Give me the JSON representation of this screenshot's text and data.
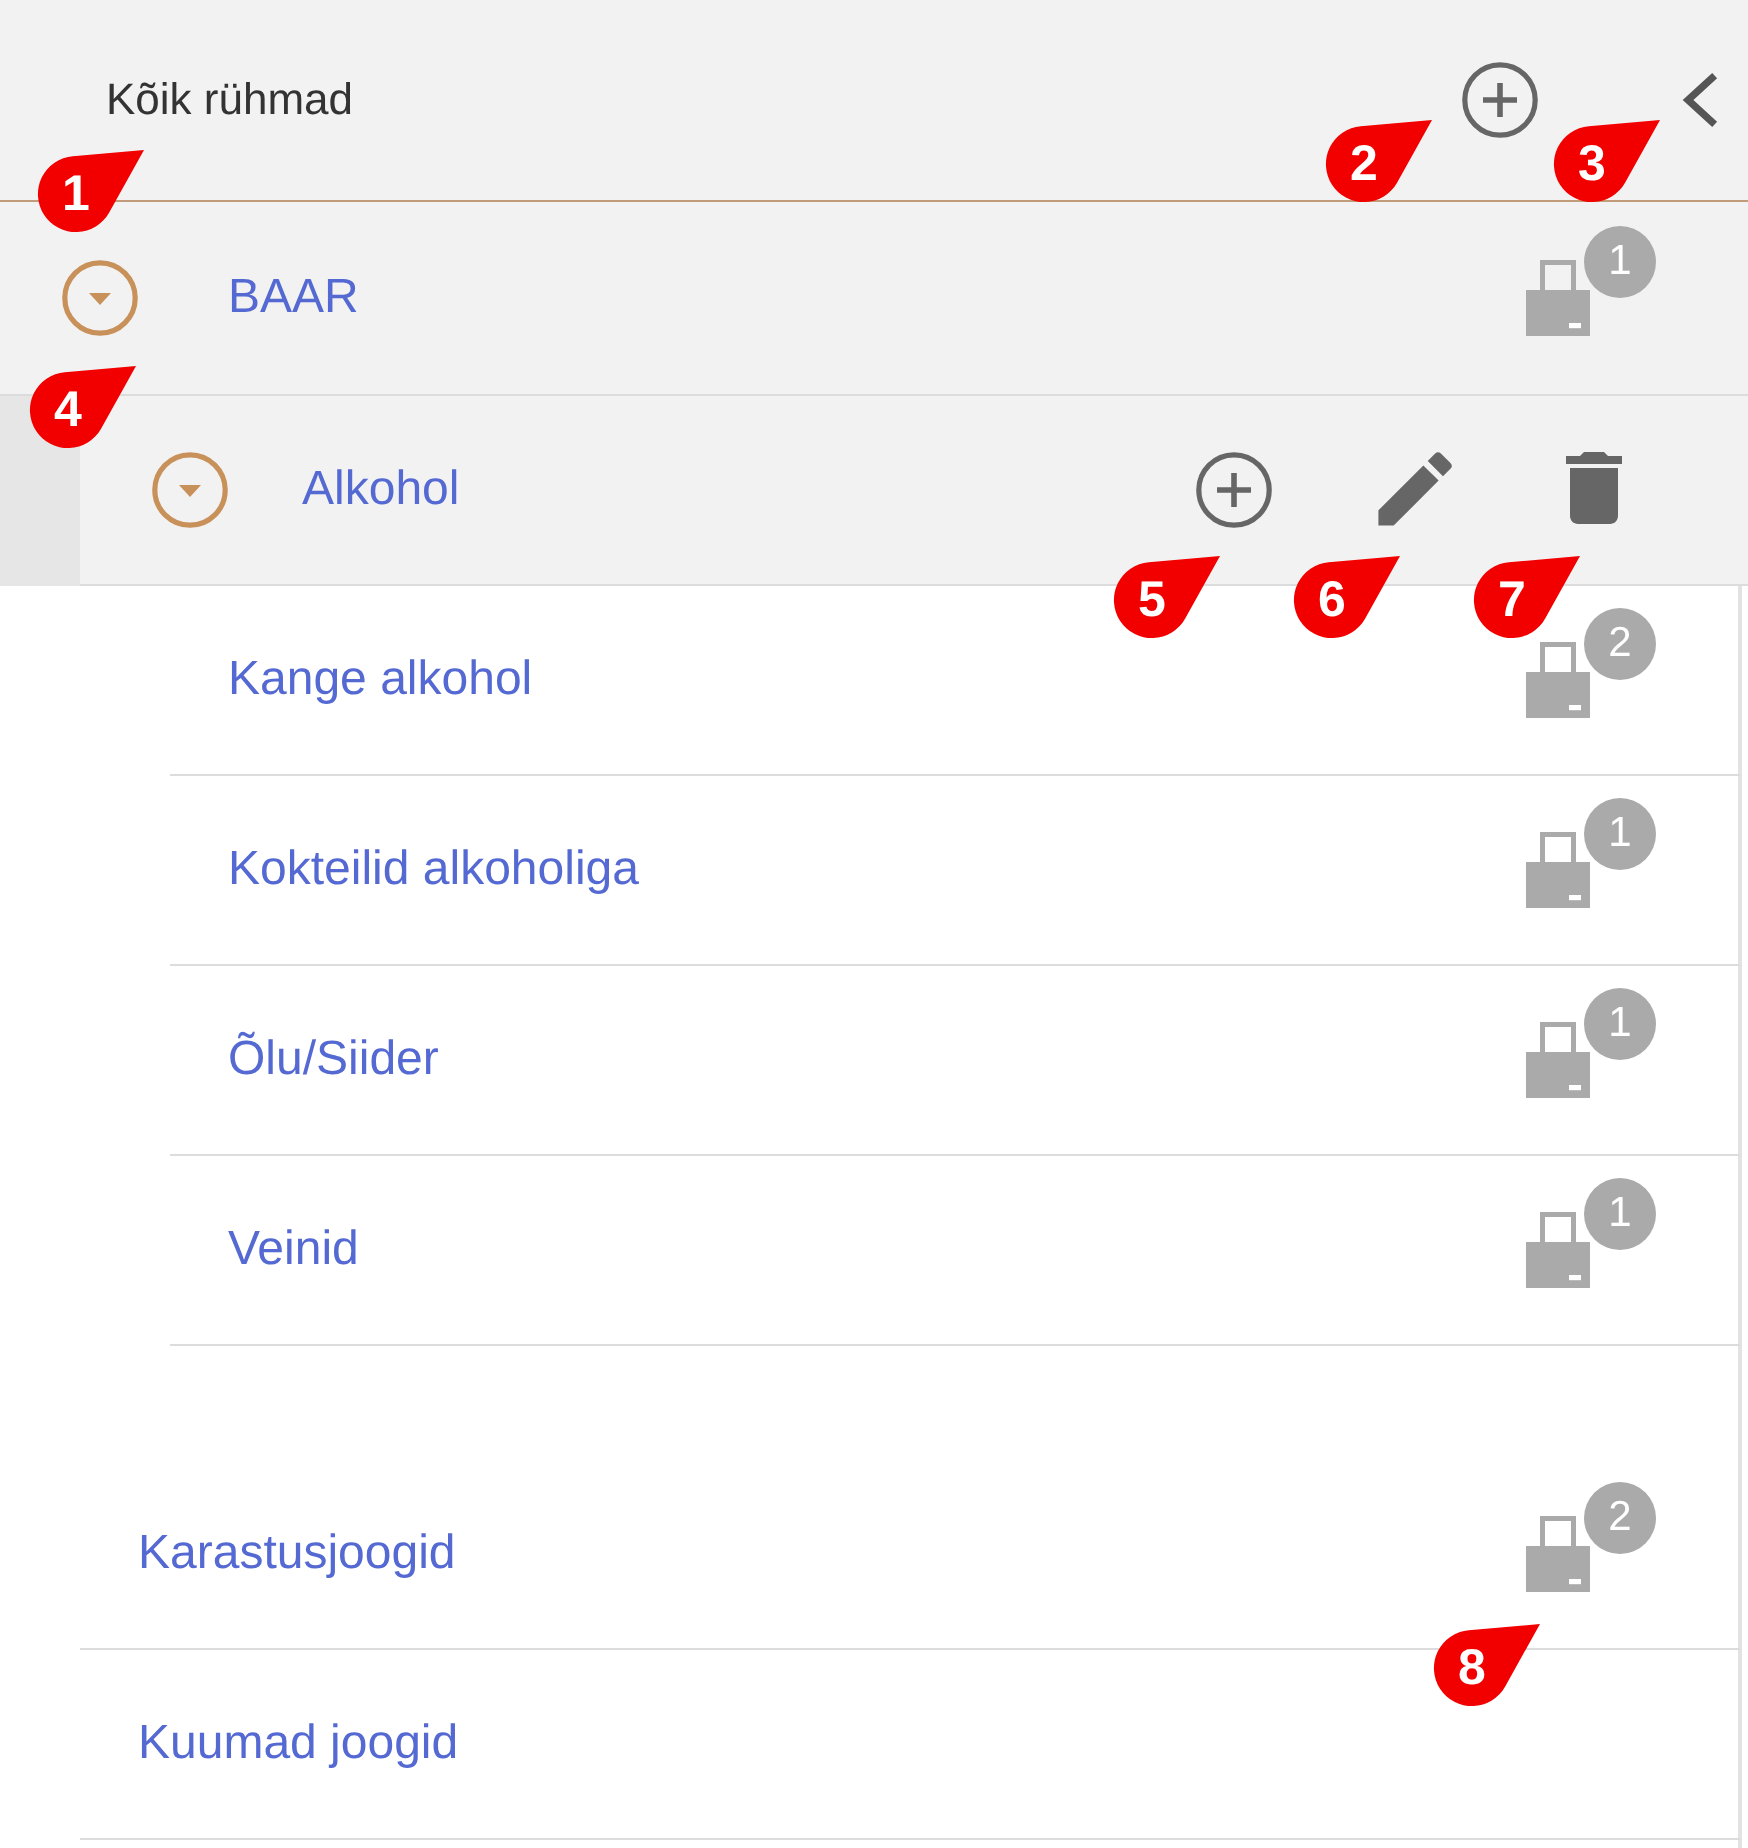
{
  "header": {
    "title": "Kõik rühmad",
    "title_callout": "1",
    "add_button": {
      "callout": "2"
    },
    "collapse_button": {
      "callout": "3"
    }
  },
  "groups": [
    {
      "name": "BAAR",
      "selected": false,
      "expanded": true,
      "printer_count": "1",
      "toggle_callout": "4",
      "children": [
        {
          "name": "Alkohol",
          "selected": true,
          "expanded": true,
          "actions": [
            {
              "kind": "add",
              "callout": "5"
            },
            {
              "kind": "edit",
              "callout": "6"
            },
            {
              "kind": "delete",
              "callout": "7"
            }
          ],
          "children": [
            {
              "name": "Kange alkohol",
              "selected": false,
              "printer_count": "2"
            },
            {
              "name": "Kokteilid alkoholiga",
              "selected": false,
              "printer_count": "1"
            },
            {
              "name": "Õlu/Siider",
              "selected": false,
              "printer_count": "1"
            },
            {
              "name": "Veinid",
              "selected": false,
              "printer_count": "1"
            }
          ]
        },
        {
          "name": "Karastusjoogid",
          "selected": false,
          "printer_count": "2",
          "printer_callout": "8"
        },
        {
          "name": "Kuumad joogid",
          "selected": false
        }
      ]
    }
  ]
}
